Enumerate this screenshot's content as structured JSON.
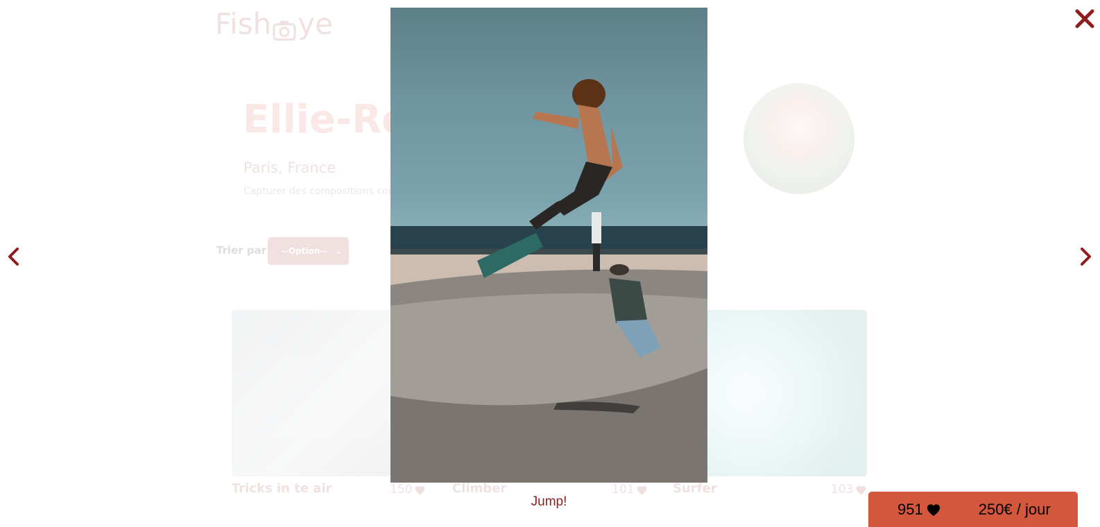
{
  "header": {
    "logo_text_left": "Fish",
    "logo_text_right": "ye"
  },
  "photographer": {
    "name": "Ellie-Rose",
    "location": "Paris, France",
    "tagline": "Capturer des compositions comp"
  },
  "sort": {
    "label": "Trier par",
    "selected": "--Option--"
  },
  "gallery": [
    {
      "title": "Tricks in te air",
      "likes": "150"
    },
    {
      "title": "Climber",
      "likes": "101"
    },
    {
      "title": "Surfer",
      "likes": "103"
    }
  ],
  "lightbox": {
    "title": "Jump!"
  },
  "stats": {
    "total_likes": "951",
    "price": "250€ / jour"
  },
  "colors": {
    "primary": "#901c1c",
    "secondary": "#d3573c"
  },
  "icons": {
    "close": "close-icon",
    "prev": "chevron-left-icon",
    "next": "chevron-right-icon",
    "heart": "heart-icon"
  }
}
